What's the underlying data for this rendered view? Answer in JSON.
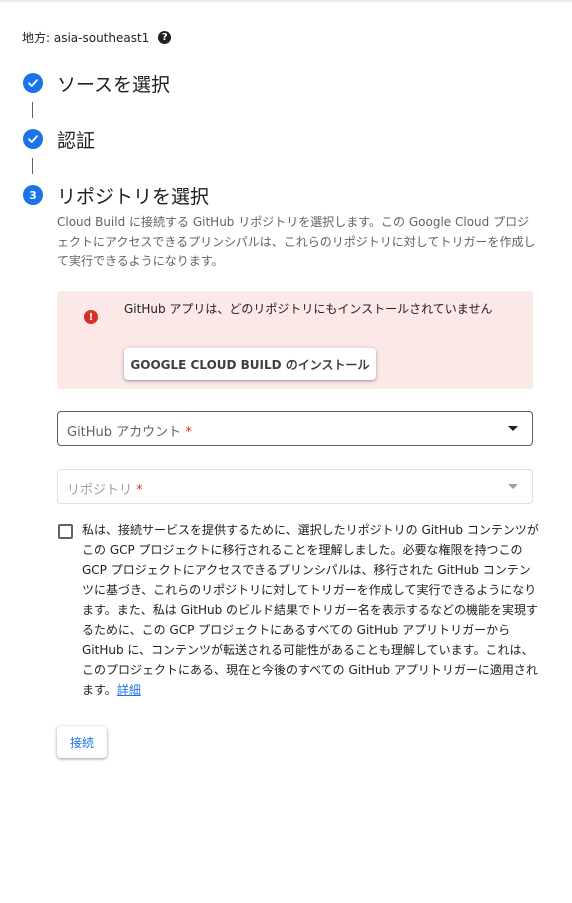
{
  "region": {
    "label": "地方: asia-southeast1",
    "help_icon": "help-circle-icon"
  },
  "steps": [
    {
      "status": "done",
      "icon": "check-icon",
      "title": "ソースを選択"
    },
    {
      "status": "done",
      "icon": "check-icon",
      "title": "認証"
    },
    {
      "status": "active",
      "number": "3",
      "title": "リポジトリを選択"
    }
  ],
  "description": "Cloud Build に接続する GitHub リポジトリを選択します。この Google Cloud プロジェクトにアクセスできるプリンシパルは、これらのリポジトリに対してトリガーを作成して実行できるようになります。",
  "alert": {
    "icon": "error-icon",
    "message": "GitHub アプリは、どのリポジトリにもインストールされていません",
    "install_button": "GOOGLE CLOUD BUILD のインストール",
    "background": "#fce8e6"
  },
  "github_account": {
    "label": "GitHub アカウント",
    "required_mark": "*"
  },
  "repository": {
    "label": "リポジトリ",
    "required_mark": "*",
    "disabled": true
  },
  "consent": {
    "checked": false,
    "text": "私は、接続サービスを提供するために、選択したリポジトリの GitHub コンテンツがこの GCP プロジェクトに移行されることを理解しました。必要な権限を持つこの GCP プロジェクトにアクセスできるプリンシパルは、移行された GitHub コンテンツに基づき、これらのリポジトリに対してトリガーを作成して実行できるようになります。また、私は GitHub のビルド結果でトリガー名を表示するなどの機能を実現するために、この GCP プロジェクトにあるすべての GitHub アプリトリガーから GitHub に、コンテンツが転送される可能性があることも理解しています。これは、このプロジェクトにある、現在と今後のすべての GitHub アプリトリガーに適用されます。",
    "link": "詳細"
  },
  "connect_button": "接続",
  "colors": {
    "accent": "#1a73e8",
    "error": "#d93025"
  }
}
